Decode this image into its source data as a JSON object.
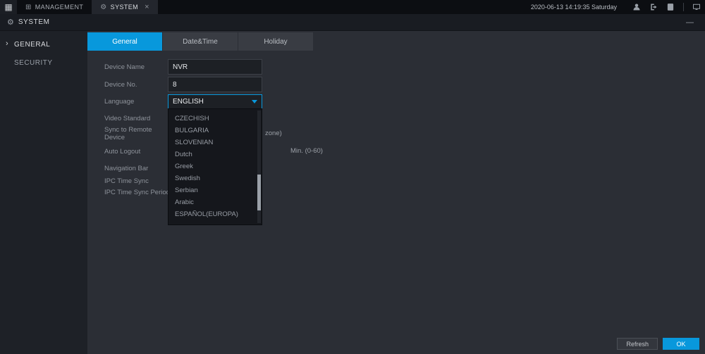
{
  "colors": {
    "accent": "#0898dc",
    "topbar_bg": "#0c0e12",
    "header_bg": "#191c22",
    "sidebar_bg": "#1e2127",
    "content_bg": "#2b2e35"
  },
  "topbar": {
    "tabs": [
      {
        "label": "MANAGEMENT",
        "active": false
      },
      {
        "label": "SYSTEM",
        "active": true,
        "closable": true
      }
    ],
    "datetime": "2020-06-13 14:19:35 Saturday",
    "close_glyph": "×"
  },
  "header": {
    "title": "SYSTEM",
    "minimize_glyph": "—"
  },
  "sidebar": {
    "items": [
      {
        "label": "GENERAL",
        "active": true,
        "arrow": "›"
      },
      {
        "label": "SECURITY",
        "active": false
      }
    ]
  },
  "tabs": [
    {
      "label": "General",
      "active": true
    },
    {
      "label": "Date&Time",
      "active": false
    },
    {
      "label": "Holiday",
      "active": false
    }
  ],
  "form": {
    "rows": [
      {
        "label": "Device Name",
        "value": "NVR"
      },
      {
        "label": "Device No.",
        "value": "8"
      },
      {
        "label": "Language",
        "value": "ENGLISH"
      },
      {
        "label": "Video Standard"
      },
      {
        "label": "Sync to Remote Device",
        "suffix": "zone)"
      },
      {
        "label": "Auto Logout",
        "suffix": "Min. (0-60)"
      },
      {
        "label": "Navigation Bar"
      },
      {
        "label": "IPC Time Sync"
      },
      {
        "label": "IPC Time Sync Period (hour)"
      }
    ]
  },
  "dropdown": {
    "options": [
      "CZECHISH",
      "BULGARIA",
      "SLOVENIAN",
      "Dutch",
      "Greek",
      "Swedish",
      "Serbian",
      "Arabic",
      "ESPAÑOL(EUROPA)"
    ]
  },
  "footer": {
    "refresh_label": "Refresh",
    "ok_label": "OK"
  },
  "icons": {
    "grid": "▦",
    "management_tab": "⊞",
    "gear": "⚙"
  }
}
